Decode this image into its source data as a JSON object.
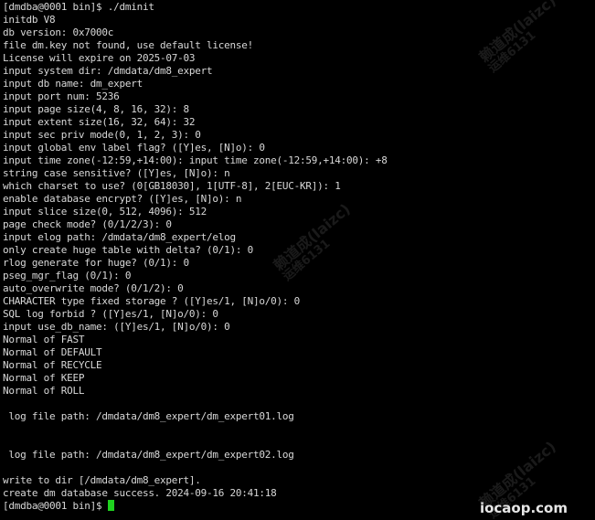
{
  "terminal": {
    "lines": [
      "[dmdba@0001 bin]$ ./dminit",
      "initdb V8",
      "db version: 0x7000c",
      "file dm.key not found, use default license!",
      "License will expire on 2025-07-03",
      "input system dir: /dmdata/dm8_expert",
      "input db name: dm_expert",
      "input port num: 5236",
      "input page size(4, 8, 16, 32): 8",
      "input extent size(16, 32, 64): 32",
      "input sec priv mode(0, 1, 2, 3): 0",
      "input global env label flag? ([Y]es, [N]o): 0",
      "input time zone(-12:59,+14:00): input time zone(-12:59,+14:00): +8",
      "string case sensitive? ([Y]es, [N]o): n",
      "which charset to use? (0[GB18030], 1[UTF-8], 2[EUC-KR]): 1",
      "enable database encrypt? ([Y]es, [N]o): n",
      "input slice size(0, 512, 4096): 512",
      "page check mode? (0/1/2/3): 0",
      "input elog path: /dmdata/dm8_expert/elog",
      "only create huge table with delta? (0/1): 0",
      "rlog generate for huge? (0/1): 0",
      "pseg_mgr_flag (0/1): 0",
      "auto_overwrite mode? (0/1/2): 0",
      "CHARACTER type fixed storage ? ([Y]es/1, [N]o/0): 0",
      "SQL log forbid ? ([Y]es/1, [N]o/0): 0",
      "input use_db_name: ([Y]es/1, [N]o/0): 0",
      "Normal of FAST",
      "Normal of DEFAULT",
      "Normal of RECYCLE",
      "Normal of KEEP",
      "Normal of ROLL",
      "",
      " log file path: /dmdata/dm8_expert/dm_expert01.log",
      "",
      "",
      " log file path: /dmdata/dm8_expert/dm_expert02.log",
      "",
      "write to dir [/dmdata/dm8_expert].",
      "create dm database success. 2024-09-16 20:41:18"
    ],
    "prompt": "[dmdba@0001 bin]$ "
  },
  "watermark": {
    "line1": "赖道成(laizc)",
    "line2": "运维6131"
  },
  "site_mark": "iocaop.com",
  "colors": {
    "background": "#000000",
    "text": "#d8d8d8",
    "cursor": "#1fd21f"
  }
}
